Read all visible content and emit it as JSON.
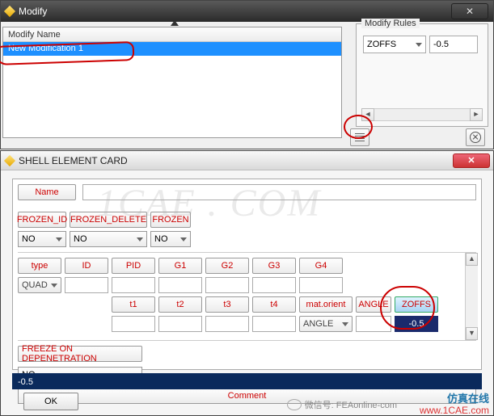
{
  "modify_window": {
    "title": "Modify",
    "list_header": "Modify Name",
    "list_item": "New Modification  1",
    "rules_legend": "Modify Rules",
    "rules_field": "ZOFFS",
    "rules_value": "-0.5"
  },
  "card_window": {
    "title": "SHELL ELEMENT CARD",
    "name_btn": "Name",
    "frozen_id": "FROZEN_ID",
    "frozen_delete": "FROZEN_DELETE",
    "frozen": "FROZEN",
    "no": "NO",
    "type": "type",
    "id": "ID",
    "pid": "PID",
    "g1": "G1",
    "g2": "G2",
    "g3": "G3",
    "g4": "G4",
    "quad": "QUAD",
    "t1": "t1",
    "t2": "t2",
    "t3": "t3",
    "t4": "t4",
    "mat_orient": "mat.orient",
    "angle": "ANGLE",
    "zoffs": "ZOFFS",
    "zoffs_val": "-0.5",
    "freeze": "FREEZE ON DEPENETRATION",
    "comment": "Comment",
    "status": "-0.5",
    "ok": "OK"
  },
  "watermarks": {
    "faded": "1CAE . COM",
    "wechat": "微信号: FEAonline-com",
    "corner1": "仿真在线",
    "corner2": "www.1CAE.com"
  }
}
